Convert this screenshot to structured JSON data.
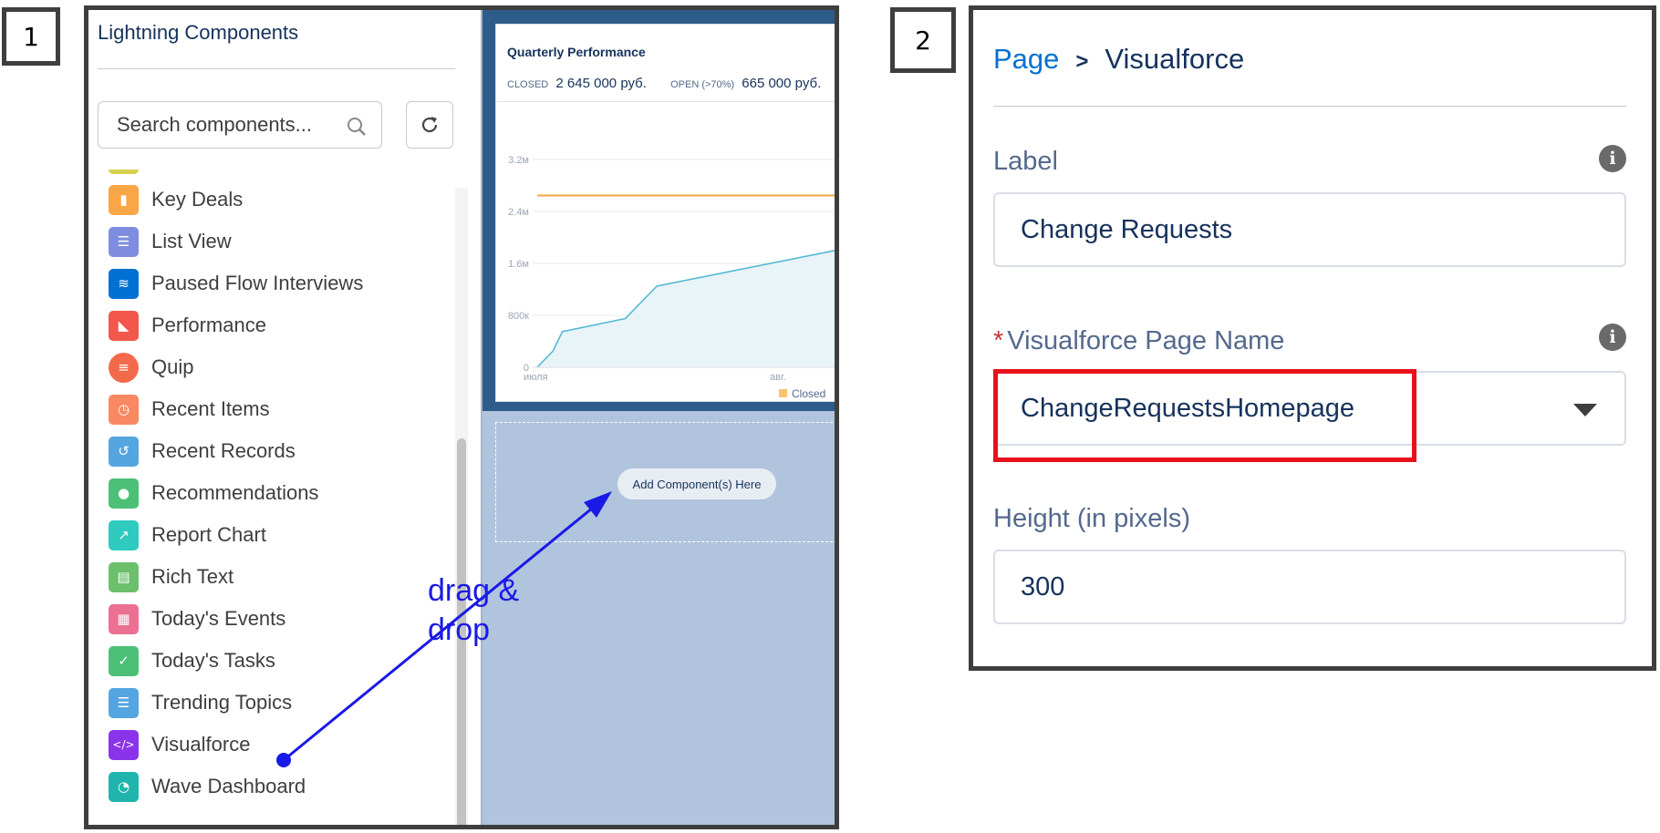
{
  "steps": {
    "one": "1",
    "two": "2"
  },
  "panel1": {
    "title": "Lightning Components",
    "search": {
      "placeholder": "Search components..."
    },
    "items": [
      {
        "label": "Key Deals",
        "icon": "bar-chart-icon",
        "color": "#f9a646"
      },
      {
        "label": "List View",
        "icon": "list-icon",
        "color": "#7f8de1"
      },
      {
        "label": "Paused Flow Interviews",
        "icon": "flow-icon",
        "color": "#0070d2"
      },
      {
        "label": "Performance",
        "icon": "performance-chart-icon",
        "color": "#f2574c"
      },
      {
        "label": "Quip",
        "icon": "quip-icon",
        "color": "#f26a4b"
      },
      {
        "label": "Recent Items",
        "icon": "clock-icon",
        "color": "#f88962"
      },
      {
        "label": "Recent Records",
        "icon": "history-icon",
        "color": "#54a5e0"
      },
      {
        "label": "Recommendations",
        "icon": "lightbulb-icon",
        "color": "#4bc076"
      },
      {
        "label": "Report Chart",
        "icon": "line-chart-icon",
        "color": "#2ecbbe"
      },
      {
        "label": "Rich Text",
        "icon": "rich-text-icon",
        "color": "#6cbf6b"
      },
      {
        "label": "Today's Events",
        "icon": "calendar-icon",
        "color": "#eb7092"
      },
      {
        "label": "Today's Tasks",
        "icon": "task-list-icon",
        "color": "#4bc076"
      },
      {
        "label": "Trending Topics",
        "icon": "topics-icon",
        "color": "#54a5e0"
      },
      {
        "label": "Visualforce",
        "icon": "code-icon",
        "color": "#8a33ea"
      },
      {
        "label": "Wave Dashboard",
        "icon": "dashboard-gauge-icon",
        "color": "#1fb5ad"
      }
    ],
    "card": {
      "title": "Quarterly Performance",
      "closed_label": "CLOSED",
      "closed_value": "2 645 000 руб.",
      "open_label": "OPEN (>70%)",
      "open_value": "665 000 руб."
    },
    "chart_data": {
      "type": "line",
      "y_ticks": [
        "3.2м",
        "2.4м",
        "1.6м",
        "800к",
        "0"
      ],
      "x_ticks": [
        "июля",
        "авг."
      ],
      "ylim": [
        0,
        3200000
      ],
      "goal_line": 2645000,
      "series": [
        {
          "name": "Closed",
          "x": [
            0,
            0.05,
            0.08,
            0.28,
            0.38,
            1.0
          ],
          "values": [
            0,
            250000,
            550000,
            750000,
            1250000,
            1850000
          ]
        }
      ],
      "colors": {
        "goal": "#f9a646",
        "line": "#54b8d6",
        "area": "#e8f4f8",
        "legend": "#f9c46b"
      }
    },
    "dropzone_label": "Add Component(s) Here",
    "annotation": {
      "line1": "drag &",
      "line2": "drop",
      "color": "#1a1ae6"
    }
  },
  "panel2": {
    "breadcrumb": {
      "parent": "Page",
      "separator": ">",
      "current": "Visualforce"
    },
    "label_field": {
      "label": "Label",
      "value": "Change Requests"
    },
    "page_name_field": {
      "required": "*",
      "label": "Visualforce Page Name",
      "value": "ChangeRequestsHomepage"
    },
    "height_field": {
      "label": "Height (in pixels)",
      "value": "300"
    },
    "highlight_color": "#e8101b"
  }
}
